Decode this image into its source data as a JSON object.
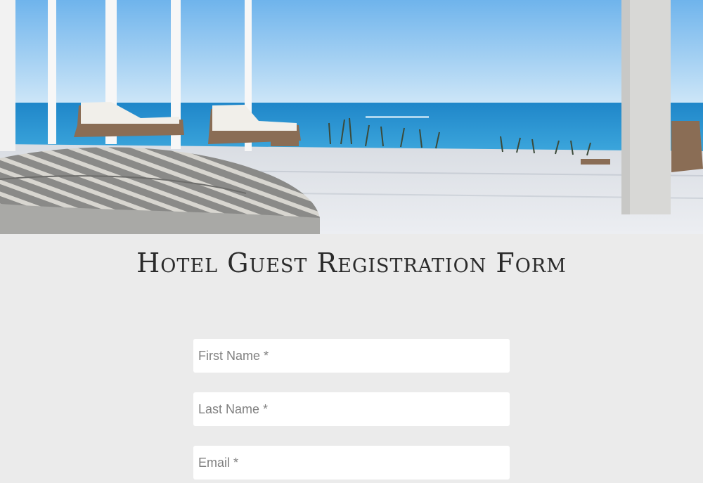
{
  "page": {
    "title": "Hotel Guest Registration Form"
  },
  "form": {
    "first_name": {
      "placeholder": "First Name *",
      "value": ""
    },
    "last_name": {
      "placeholder": "Last Name *",
      "value": ""
    },
    "email": {
      "placeholder": "Email *",
      "value": ""
    }
  },
  "colors": {
    "background": "#ebebeb",
    "field_background": "#ffffff",
    "title_text": "#2a2a2a",
    "placeholder_text": "#808080"
  }
}
